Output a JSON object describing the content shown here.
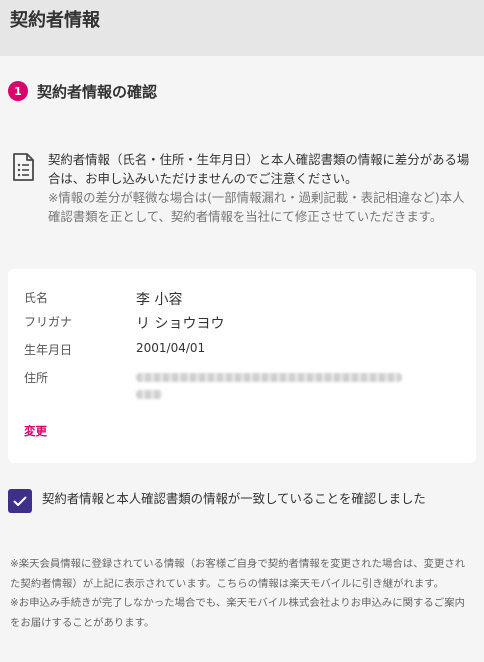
{
  "header": {
    "title": "契約者情報"
  },
  "section": {
    "step_number": "1",
    "title": "契約者情報の確認"
  },
  "notice": {
    "icon": "document-list-icon",
    "main_text": "契約者情報（氏名・住所・生年月日）と本人確認書類の情報に差分がある場合は、お申し込みいただけませんのでご注意ください。",
    "sub_text": "※情報の差分が軽微な場合は(一部情報漏れ・過剰記載・表記相違など)本人確認書類を正として、契約者情報を当社にて修正させていただきます。"
  },
  "contract": {
    "name_label": "氏名",
    "name_value": "李 小容",
    "kana_label": "フリガナ",
    "kana_value": "リ ショウヨウ",
    "birth_label": "生年月日",
    "birth_value": "2001/04/01",
    "address_label": "住所",
    "change_label": "変更"
  },
  "confirm": {
    "checked": true,
    "label": "契約者情報と本人確認書類の情報が一致していることを確認しました"
  },
  "footnote": {
    "line1": "※楽天会員情報に登録されている情報（お客様ご自身で契約者情報を変更された場合は、変更された契約者情報）が上記に表示されています。こちらの情報は楽天モバイルに引き継がれます。",
    "line2": "※お申込み手続きが完了しなかった場合でも、楽天モバイル株式会社よりお申込みに関するご案内をお届けすることがあります。"
  },
  "colors": {
    "accent": "#d9006c",
    "checkbox": "#3e3089",
    "background": "#f5f5f5"
  }
}
